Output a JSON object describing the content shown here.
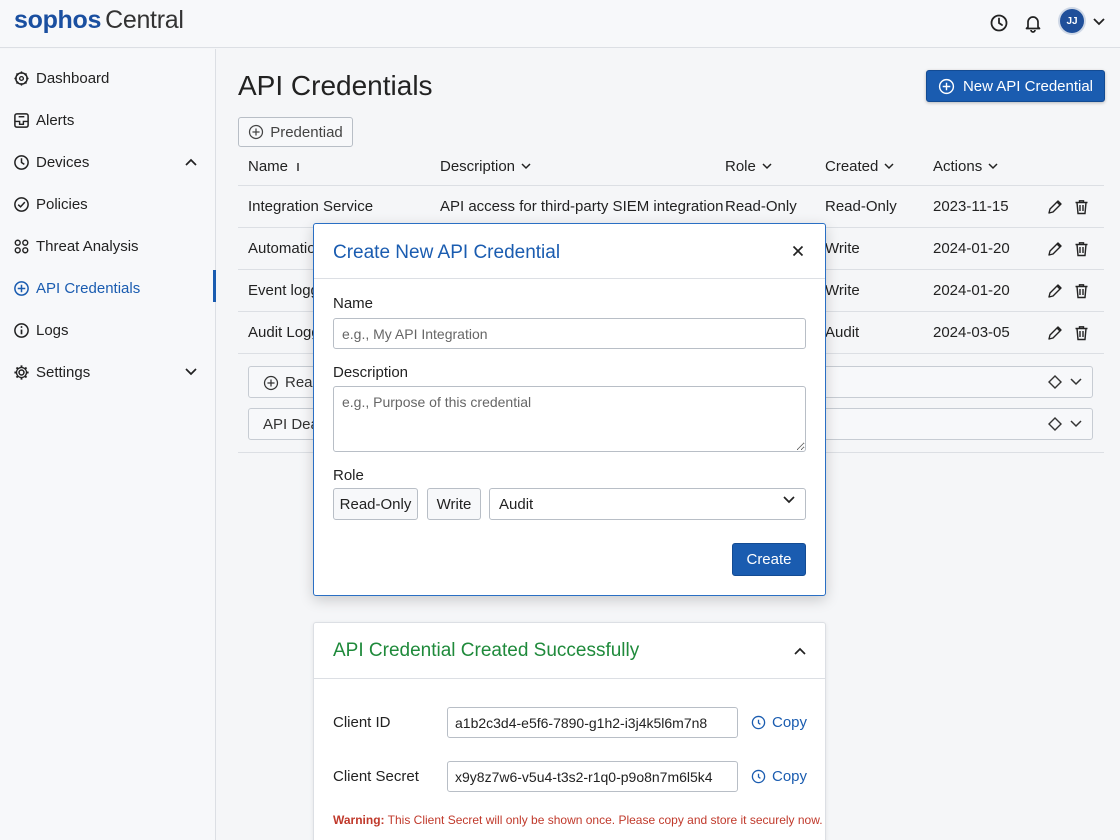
{
  "header": {
    "brand": "sophos",
    "product": "Central",
    "avatar_initials": "JJ"
  },
  "sidebar": {
    "items": [
      {
        "label": "Dashboard",
        "icon": "dashboard-icon"
      },
      {
        "label": "Alerts",
        "icon": "alerts-icon"
      },
      {
        "label": "Devices",
        "icon": "devices-icon",
        "expandable": true
      },
      {
        "label": "Policies",
        "icon": "policies-icon"
      },
      {
        "label": "Threat Analysis",
        "icon": "threat-analysis-icon"
      },
      {
        "label": "API Credentials",
        "icon": "api-credentials-icon",
        "active": true
      },
      {
        "label": "Logs",
        "icon": "logs-icon"
      },
      {
        "label": "Settings",
        "icon": "settings-icon",
        "expandable": true
      }
    ]
  },
  "main": {
    "title": "API Credentials",
    "new_button": "New API Credential",
    "filter_button": "Predentiad",
    "columns": [
      "Name",
      "Description",
      "Role",
      "Created",
      "Actions"
    ],
    "rows": [
      {
        "name": "Integration Service",
        "description": "API access for third-party SIEM integration",
        "role": "Read-Only",
        "created_col": "Read-Only",
        "date": "2023-11-15"
      },
      {
        "name": "Automation",
        "description": "",
        "role": "",
        "created_col": "Write",
        "date": "2024-01-20"
      },
      {
        "name": "Event logg",
        "description": "",
        "role": "",
        "created_col": "Write",
        "date": "2024-01-20"
      },
      {
        "name": "Audit Logg",
        "description": "",
        "role": "",
        "created_col": "Audit",
        "date": "2024-03-05"
      }
    ],
    "bar_rows": [
      {
        "label": "Read",
        "has_plus": true
      },
      {
        "label": "API Dea",
        "has_plus": false
      }
    ]
  },
  "modal": {
    "title": "Create New API Credential",
    "name_label": "Name",
    "name_placeholder": "e.g., My API Integration",
    "description_label": "Description",
    "description_placeholder": "e.g., Purpose of this credential",
    "role_label": "Role",
    "role_options": [
      "Read-Only",
      "Write"
    ],
    "role_selected": "Audit",
    "create_button": "Create"
  },
  "success": {
    "title": "API Credential Created Successfully",
    "client_id_label": "Client ID",
    "client_id": "a1b2c3d4-e5f6-7890-g1h2-i3j4k5l6m7n8",
    "client_secret_label": "Client Secret",
    "client_secret": "x9y8z7w6-v5u4-t3s2-r1q0-p9o8n7m6l5k4",
    "copy_label": "Copy",
    "warning_prefix": "Warning:",
    "warning_text": "This Client Secret will only be shown once. Please copy and store it securely now."
  },
  "colors": {
    "accent": "#1a5cb0",
    "success": "#1f8a3b",
    "warning": "#c0392b"
  }
}
